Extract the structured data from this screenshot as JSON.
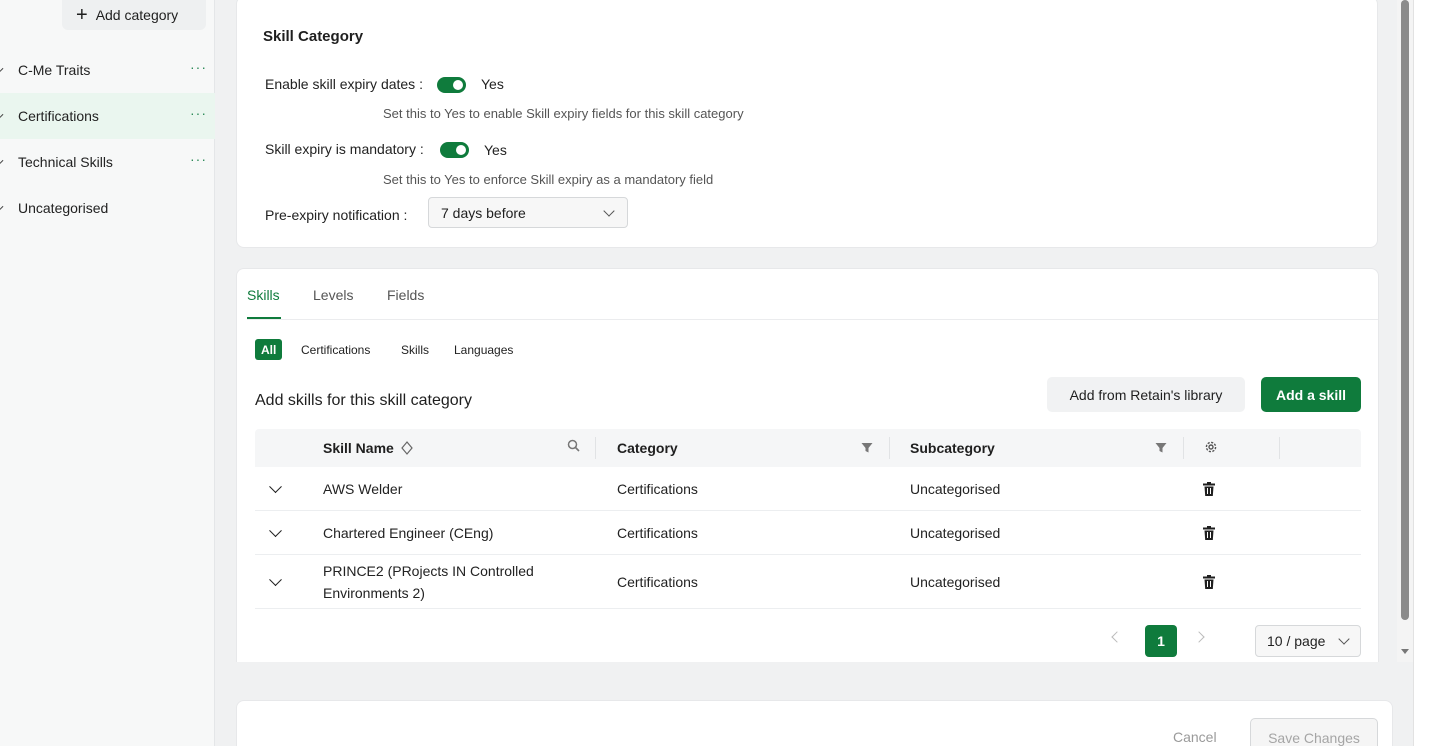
{
  "sidebar": {
    "add_category": "Add category",
    "items": [
      {
        "label": "C-Me Traits",
        "more": "···"
      },
      {
        "label": "Certifications",
        "more": "···"
      },
      {
        "label": "Technical Skills",
        "more": "···"
      },
      {
        "label": "Uncategorised"
      }
    ]
  },
  "settings": {
    "title": "Skill Category",
    "expiry_dates": {
      "label": "Enable skill expiry dates :",
      "value": "Yes",
      "hint": "Set this to Yes to enable Skill expiry fields for this skill category"
    },
    "expiry_mandatory": {
      "label": "Skill expiry is mandatory :",
      "value": "Yes",
      "hint": "Set this to Yes to enforce Skill expiry as a mandatory field"
    },
    "pre_expiry": {
      "label": "Pre-expiry notification :",
      "value": "7 days before"
    }
  },
  "tabs": [
    "Skills",
    "Levels",
    "Fields"
  ],
  "filters": [
    "All",
    "Certifications",
    "Skills",
    "Languages"
  ],
  "section_title": "Add skills for this skill category",
  "buttons": {
    "add_from_library": "Add from Retain's library",
    "add_skill": "Add a skill",
    "cancel": "Cancel",
    "save": "Save Changes"
  },
  "table": {
    "columns": [
      "Skill Name",
      "Category",
      "Subcategory"
    ],
    "rows": [
      {
        "name": "AWS Welder",
        "category": "Certifications",
        "subcategory": "Uncategorised"
      },
      {
        "name": "Chartered Engineer (CEng)",
        "category": "Certifications",
        "subcategory": "Uncategorised"
      },
      {
        "name": "PRINCE2 (PRojects IN Controlled Environments 2)",
        "category": "Certifications",
        "subcategory": "Uncategorised"
      }
    ]
  },
  "pagination": {
    "current": "1",
    "page_size": "10 / page"
  },
  "colors": {
    "accent": "#0f7b3c",
    "active_bg": "#eaf6ef"
  }
}
